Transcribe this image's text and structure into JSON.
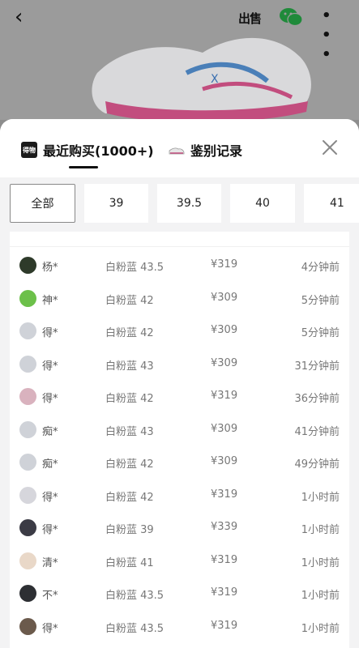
{
  "top": {
    "sell_label": "出售",
    "more_label": "• • •",
    "back_label": "‹"
  },
  "tabs": [
    {
      "label": "最近购买(1000+)",
      "icon_text": "得物",
      "icon": "dewu-logo-icon"
    },
    {
      "label": "鉴别记录",
      "icon": "shoe-icon"
    }
  ],
  "sizes": [
    "全部",
    "39",
    "39.5",
    "40",
    "41"
  ],
  "records": [
    {
      "user": "杨*",
      "spec": "白粉蓝 43.5",
      "price": "¥319",
      "time": "4分钟前",
      "avatar": "#2e3a2a"
    },
    {
      "user": "神*",
      "spec": "白粉蓝 42",
      "price": "¥309",
      "time": "5分钟前",
      "avatar": "#6cc04a"
    },
    {
      "user": "得*",
      "spec": "白粉蓝 42",
      "price": "¥309",
      "time": "5分钟前",
      "avatar": "#cfd2d8"
    },
    {
      "user": "得*",
      "spec": "白粉蓝 43",
      "price": "¥309",
      "time": "31分钟前",
      "avatar": "#cfd2d8"
    },
    {
      "user": "得*",
      "spec": "白粉蓝 42",
      "price": "¥319",
      "time": "36分钟前",
      "avatar": "#d9b2be"
    },
    {
      "user": "痴*",
      "spec": "白粉蓝 43",
      "price": "¥309",
      "time": "41分钟前",
      "avatar": "#cfd2d8"
    },
    {
      "user": "痴*",
      "spec": "白粉蓝 42",
      "price": "¥309",
      "time": "49分钟前",
      "avatar": "#cfd2d8"
    },
    {
      "user": "得*",
      "spec": "白粉蓝 42",
      "price": "¥319",
      "time": "1小时前",
      "avatar": "#d6d6dc"
    },
    {
      "user": "得*",
      "spec": "白粉蓝 39",
      "price": "¥339",
      "time": "1小时前",
      "avatar": "#3b3b45"
    },
    {
      "user": "清*",
      "spec": "白粉蓝 41",
      "price": "¥319",
      "time": "1小时前",
      "avatar": "#e9d8c8"
    },
    {
      "user": "不*",
      "spec": "白粉蓝 43.5",
      "price": "¥319",
      "time": "1小时前",
      "avatar": "#2d2f33"
    },
    {
      "user": "得*",
      "spec": "白粉蓝 43.5",
      "price": "¥319",
      "time": "1小时前",
      "avatar": "#6b5a4c"
    }
  ]
}
